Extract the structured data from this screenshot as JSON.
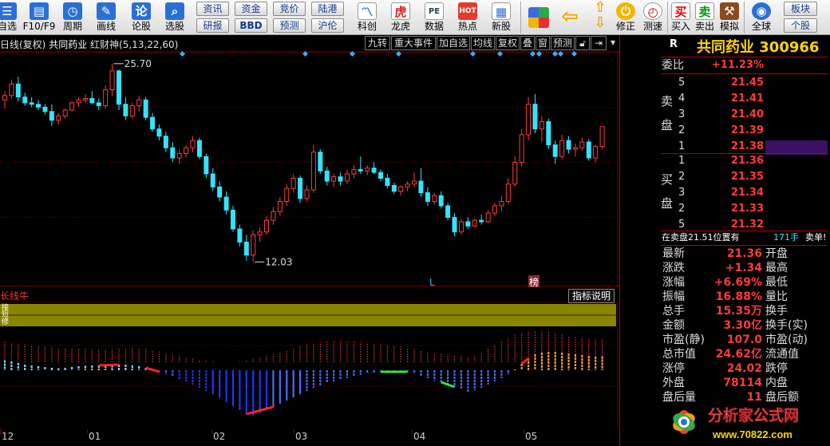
{
  "toolbar": {
    "buttons": [
      {
        "label": "自选",
        "icon": "star-list-icon",
        "color": "#2a6fd6"
      },
      {
        "label": "F10/F9",
        "icon": "f10-icon",
        "color": "#2a6fd6"
      },
      {
        "label": "周期",
        "icon": "clock-icon",
        "color": "#2a6fd6"
      },
      {
        "label": "画线",
        "icon": "pencil-icon",
        "color": "#2a6fd6"
      },
      {
        "label": "论股",
        "icon": "talk-icon",
        "color": "#2a6fd6"
      },
      {
        "label": "选股",
        "icon": "magnifier-icon",
        "color": "#2a6fd6"
      }
    ],
    "small_buttons": [
      "资讯",
      "资金",
      "竞价",
      "陆港",
      "研报",
      "BBD",
      "预测",
      "沪伦"
    ],
    "mid_buttons": [
      {
        "label": "科创",
        "icon": "chart-icon"
      },
      {
        "label": "龙虎",
        "icon": "tiger-icon"
      },
      {
        "label": "数据",
        "icon": "pe-icon"
      },
      {
        "label": "热点",
        "icon": "hot-icon"
      },
      {
        "label": "新股",
        "icon": "new-stock-icon"
      }
    ],
    "right_buttons": [
      {
        "label": "修正",
        "icon": "refresh-icon"
      },
      {
        "label": "测速",
        "icon": "speed-icon"
      },
      {
        "label": "买入",
        "icon": "buy-icon"
      },
      {
        "label": "卖出",
        "icon": "sell-icon"
      },
      {
        "label": "模拟",
        "icon": "gavel-icon"
      },
      {
        "label": "全球",
        "icon": "globe-icon"
      }
    ],
    "far_right": [
      "板块",
      "个股"
    ]
  },
  "chart_header": {
    "period": "日线(复权)",
    "stock": "共同药业",
    "indicator": "红财神(5,13,22,60)",
    "buttons": [
      "九转",
      "重大事件",
      "加自选",
      "均线",
      "复权",
      "叠",
      "窗",
      "预测"
    ]
  },
  "indicator": {
    "name": "长线牛",
    "button": "指标说明",
    "band_labels": [
      "接",
      "短",
      "修"
    ]
  },
  "chart_data": [
    {
      "type": "candlestick",
      "title": "日线(复权) 共同药业 红财神(5,13,22,60)",
      "yticks": [
        26.46,
        22.68,
        18.89,
        15.11
      ],
      "ylim": [
        11.0,
        26.46
      ],
      "annotations": [
        {
          "text": "25.70",
          "kind": "high"
        },
        {
          "text": "12.03",
          "kind": "low"
        }
      ],
      "markers": [
        "L",
        "榜"
      ],
      "xticks": [
        "12",
        "01",
        "02",
        "03",
        "04",
        "05"
      ],
      "candles": [
        [
          23.2,
          23.8,
          22.6,
          23.5
        ],
        [
          23.5,
          24.6,
          23.3,
          24.3
        ],
        [
          24.3,
          24.8,
          23.1,
          23.4
        ],
        [
          23.4,
          23.7,
          22.8,
          23.0
        ],
        [
          23.0,
          23.4,
          22.7,
          22.9
        ],
        [
          22.9,
          23.2,
          22.5,
          22.7
        ],
        [
          22.7,
          22.9,
          22.2,
          22.4
        ],
        [
          22.4,
          22.9,
          21.4,
          21.8
        ],
        [
          21.8,
          22.3,
          21.5,
          22.1
        ],
        [
          22.1,
          22.6,
          21.9,
          22.5
        ],
        [
          22.5,
          23.1,
          22.4,
          23.0
        ],
        [
          23.0,
          23.4,
          22.7,
          23.2
        ],
        [
          23.2,
          23.6,
          23.0,
          23.3
        ],
        [
          23.3,
          23.8,
          22.9,
          23.0
        ],
        [
          23.0,
          23.3,
          22.5,
          22.8
        ],
        [
          22.8,
          24.2,
          22.6,
          23.9
        ],
        [
          23.9,
          25.7,
          23.5,
          25.2
        ],
        [
          25.2,
          25.3,
          22.5,
          22.9
        ],
        [
          22.9,
          23.4,
          21.8,
          22.1
        ],
        [
          22.1,
          23.0,
          21.9,
          22.8
        ],
        [
          22.8,
          23.5,
          22.4,
          23.2
        ],
        [
          23.2,
          23.4,
          21.8,
          22.0
        ],
        [
          22.0,
          22.3,
          21.0,
          21.2
        ],
        [
          21.2,
          21.5,
          20.4,
          20.7
        ],
        [
          20.7,
          21.0,
          19.6,
          19.9
        ],
        [
          19.9,
          20.3,
          18.9,
          19.2
        ],
        [
          19.2,
          19.8,
          18.8,
          19.5
        ],
        [
          19.5,
          20.1,
          19.2,
          19.9
        ],
        [
          19.9,
          20.7,
          19.6,
          20.4
        ],
        [
          20.4,
          20.6,
          19.1,
          19.3
        ],
        [
          19.3,
          19.5,
          17.8,
          18.1
        ],
        [
          18.1,
          18.5,
          16.9,
          17.2
        ],
        [
          17.2,
          17.6,
          16.2,
          16.5
        ],
        [
          16.5,
          16.9,
          15.3,
          15.6
        ],
        [
          15.6,
          15.9,
          14.1,
          14.3
        ],
        [
          14.3,
          14.6,
          13.1,
          13.4
        ],
        [
          13.4,
          13.9,
          12.1,
          12.5
        ],
        [
          12.5,
          14.2,
          12.03,
          13.9
        ],
        [
          13.9,
          14.4,
          13.4,
          14.1
        ],
        [
          14.1,
          15.2,
          13.9,
          14.9
        ],
        [
          14.9,
          15.8,
          14.6,
          15.5
        ],
        [
          15.5,
          16.5,
          15.2,
          16.2
        ],
        [
          16.2,
          17.4,
          15.9,
          17.1
        ],
        [
          17.1,
          18.1,
          16.8,
          17.8
        ],
        [
          17.8,
          18.0,
          16.1,
          16.4
        ],
        [
          16.4,
          17.3,
          16.2,
          17.0
        ],
        [
          17.0,
          20.1,
          16.8,
          19.6
        ],
        [
          19.6,
          19.8,
          18.1,
          18.3
        ],
        [
          18.3,
          18.6,
          17.3,
          17.6
        ],
        [
          17.6,
          18.1,
          17.2,
          17.9
        ],
        [
          17.9,
          18.2,
          17.3,
          17.6
        ],
        [
          17.6,
          18.4,
          17.4,
          18.1
        ],
        [
          18.1,
          18.7,
          17.8,
          18.4
        ],
        [
          18.4,
          19.3,
          18.1,
          18.3
        ],
        [
          18.3,
          18.7,
          18.0,
          18.5
        ],
        [
          18.5,
          18.9,
          18.1,
          18.2
        ],
        [
          18.2,
          18.4,
          17.6,
          17.8
        ],
        [
          17.8,
          18.1,
          17.1,
          17.3
        ],
        [
          17.3,
          17.5,
          16.7,
          16.9
        ],
        [
          16.9,
          17.3,
          16.6,
          17.2
        ],
        [
          17.2,
          17.6,
          16.9,
          17.4
        ],
        [
          17.4,
          18.2,
          17.2,
          17.6
        ],
        [
          17.6,
          18.5,
          16.5,
          16.8
        ],
        [
          16.8,
          17.2,
          15.9,
          16.2
        ],
        [
          16.2,
          16.8,
          16.0,
          16.6
        ],
        [
          16.6,
          16.9,
          15.7,
          15.9
        ],
        [
          15.9,
          16.1,
          14.9,
          15.1
        ],
        [
          15.1,
          15.4,
          13.8,
          14.1
        ],
        [
          14.1,
          15.0,
          13.9,
          14.8
        ],
        [
          14.8,
          15.1,
          14.3,
          14.5
        ],
        [
          14.5,
          15.0,
          14.4,
          14.9
        ],
        [
          14.9,
          15.3,
          14.6,
          14.8
        ],
        [
          14.8,
          15.6,
          14.7,
          15.4
        ],
        [
          15.4,
          16.1,
          15.2,
          15.9
        ],
        [
          15.9,
          16.6,
          15.5,
          16.2
        ],
        [
          16.2,
          17.8,
          16.0,
          17.4
        ],
        [
          17.4,
          19.3,
          17.2,
          18.9
        ],
        [
          18.9,
          21.2,
          18.6,
          20.8
        ],
        [
          20.8,
          23.4,
          20.4,
          22.9
        ],
        [
          22.9,
          23.6,
          20.9,
          21.2
        ],
        [
          21.2,
          22.1,
          20.3,
          21.7
        ],
        [
          21.7,
          21.9,
          19.8,
          20.1
        ],
        [
          20.1,
          20.4,
          18.8,
          19.3
        ],
        [
          19.3,
          20.8,
          19.1,
          20.4
        ],
        [
          20.4,
          20.7,
          19.5,
          19.8
        ],
        [
          19.8,
          20.2,
          19.3,
          19.9
        ],
        [
          19.9,
          20.6,
          19.7,
          20.3
        ],
        [
          20.3,
          20.5,
          19.0,
          19.2
        ],
        [
          19.2,
          20.1,
          18.9,
          20.0
        ],
        [
          20.0,
          21.2,
          19.8,
          21.36
        ]
      ]
    },
    {
      "type": "bar",
      "title": "长线牛",
      "yticks": [
        180.0,
        80.69,
        -18.62
      ],
      "ylim": [
        -120,
        200
      ],
      "values": [
        25,
        22,
        18,
        14,
        12,
        10,
        8,
        6,
        5,
        6,
        8,
        10,
        11,
        12,
        12,
        12,
        13,
        14,
        14,
        12,
        10,
        6,
        2,
        -4,
        -10,
        -16,
        -22,
        -28,
        -36,
        -44,
        -52,
        -60,
        -70,
        -80,
        -90,
        -100,
        -110,
        -114,
        -108,
        -100,
        -92,
        -84,
        -76,
        -68,
        -60,
        -52,
        -44,
        -38,
        -32,
        -28,
        -24,
        -20,
        -16,
        -12,
        -8,
        -6,
        -4,
        -2,
        -1,
        -2,
        -4,
        -8,
        -14,
        -20,
        -26,
        -30,
        -36,
        -42,
        -48,
        -54,
        -50,
        -44,
        -36,
        -28,
        -20,
        -10,
        2,
        16,
        30,
        40,
        44,
        46,
        46,
        44,
        42,
        40,
        38,
        36,
        34,
        35
      ],
      "upper_values": [
        60,
        55,
        52,
        50,
        48,
        46,
        44,
        42,
        40,
        40,
        40,
        40,
        38,
        36,
        36,
        36,
        36,
        38,
        40,
        42,
        40,
        38,
        34,
        30,
        26,
        22,
        18,
        14,
        10,
        6,
        4,
        2,
        0,
        0,
        0,
        2,
        6,
        10,
        14,
        18,
        22,
        28,
        34,
        40,
        46,
        50,
        54,
        56,
        58,
        60,
        62,
        60,
        58,
        56,
        54,
        52,
        50,
        48,
        46,
        44,
        40,
        36,
        32,
        28,
        26,
        24,
        22,
        20,
        18,
        16,
        20,
        28,
        38,
        48,
        58,
        68,
        76,
        82,
        86,
        88,
        88,
        86,
        82,
        78,
        74,
        70,
        68,
        66,
        64,
        64
      ]
    }
  ],
  "panel": {
    "header_mark": "R",
    "stock_name": "共同药业",
    "stock_code": "300966",
    "weibi_label": "委比",
    "weibi_value": "+11.23%",
    "sell_chars": [
      "卖",
      "盘"
    ],
    "buy_chars": [
      "买",
      "盘"
    ],
    "sell_levels": [
      {
        "level": "5",
        "price": "21.45"
      },
      {
        "level": "4",
        "price": "21.41"
      },
      {
        "level": "3",
        "price": "21.40"
      },
      {
        "level": "2",
        "price": "21.39"
      },
      {
        "level": "1",
        "price": "21.38"
      }
    ],
    "buy_levels": [
      {
        "level": "1",
        "price": "21.36"
      },
      {
        "level": "2",
        "price": "21.35"
      },
      {
        "level": "3",
        "price": "21.34"
      },
      {
        "level": "2",
        "price": "21.33"
      },
      {
        "level": "5",
        "price": "21.32"
      }
    ],
    "big_order_text": "在卖盘21.51位置有",
    "big_order_qty": "171手",
    "big_order_tag": "卖单!",
    "quotes": [
      {
        "l1": "最新",
        "v": "21.36",
        "l2": "开盘"
      },
      {
        "l1": "涨跌",
        "v": "+1.34",
        "l2": "最高"
      },
      {
        "l1": "涨幅",
        "v": "+6.69%",
        "l2": "最低"
      },
      {
        "l1": "振幅",
        "v": "16.88%",
        "l2": "量比"
      },
      {
        "l1": "总手",
        "v": "15.35万",
        "l2": "换手"
      },
      {
        "l1": "金额",
        "v": "3.30亿",
        "l2": "换手(实)"
      },
      {
        "l1": "市盈(静)",
        "v": "107.0",
        "l2": "市盈(动)"
      },
      {
        "l1": "总市值",
        "v": "24.62亿",
        "l2": "流通值"
      },
      {
        "l1": "涨停",
        "v": "24.02",
        "l2": "跌停"
      },
      {
        "l1": "外盘",
        "v": "78114",
        "l2": "内盘"
      },
      {
        "l1": "盘后量",
        "v": "11",
        "l2": "盘后额"
      }
    ],
    "logo_text": "分析家公式网",
    "logo_url_text": "www.70822.com"
  },
  "colors": {
    "up": "#ff3b3b",
    "down": "#33e3ff",
    "grid": "#7a0000",
    "gold": "#ffd400"
  }
}
